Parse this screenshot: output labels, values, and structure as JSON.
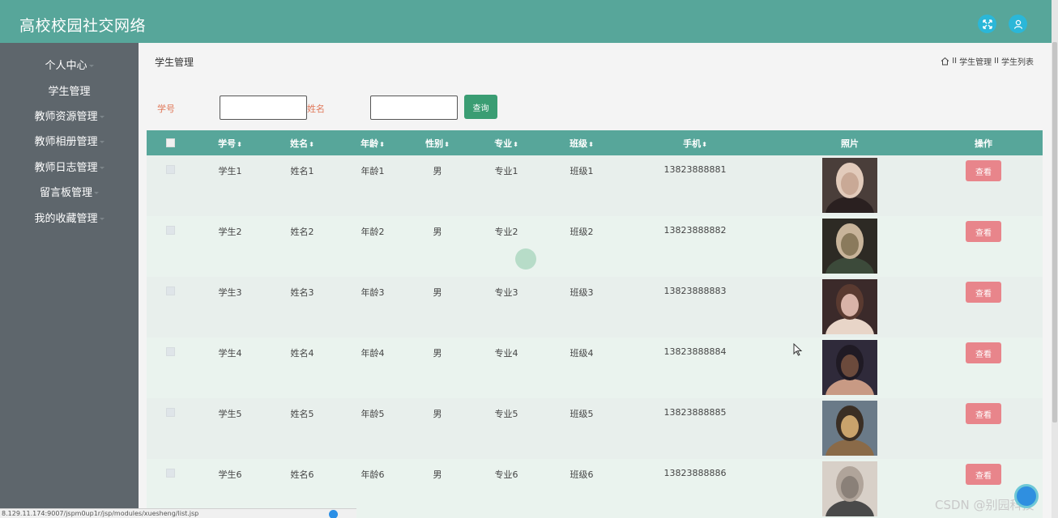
{
  "app": {
    "title": "高校校园社交网络"
  },
  "header": {
    "icons": [
      "fullscreen-icon",
      "user-icon"
    ]
  },
  "sidebar": {
    "items": [
      {
        "label": "个人中心",
        "caret": true
      },
      {
        "label": "学生管理",
        "caret": false
      },
      {
        "label": "教师资源管理",
        "caret": true
      },
      {
        "label": "教师相册管理",
        "caret": true
      },
      {
        "label": "教师日志管理",
        "caret": true
      },
      {
        "label": "留言板管理",
        "caret": true
      },
      {
        "label": "我的收藏管理",
        "caret": true
      }
    ]
  },
  "main": {
    "title": "学生管理",
    "breadcrumb": {
      "separator": "II",
      "items": [
        "学生管理",
        "学生列表"
      ]
    }
  },
  "search": {
    "fields": [
      {
        "label": "学号",
        "value": ""
      },
      {
        "label": "姓名",
        "value": ""
      }
    ],
    "button_label": "查询"
  },
  "table": {
    "headers": [
      "学号",
      "姓名",
      "年龄",
      "性别",
      "专业",
      "班级",
      "手机",
      "照片",
      "操作"
    ],
    "sortable": [
      true,
      true,
      true,
      true,
      true,
      true,
      true,
      false,
      false
    ],
    "action_label": "查看",
    "rows": [
      {
        "id": "学生1",
        "name": "姓名1",
        "age": "年龄1",
        "gender": "男",
        "major": "专业1",
        "class": "班级1",
        "phone": "13823888881"
      },
      {
        "id": "学生2",
        "name": "姓名2",
        "age": "年龄2",
        "gender": "男",
        "major": "专业2",
        "class": "班级2",
        "phone": "13823888882"
      },
      {
        "id": "学生3",
        "name": "姓名3",
        "age": "年龄3",
        "gender": "男",
        "major": "专业3",
        "class": "班级3",
        "phone": "13823888883"
      },
      {
        "id": "学生4",
        "name": "姓名4",
        "age": "年龄4",
        "gender": "男",
        "major": "专业4",
        "class": "班级4",
        "phone": "13823888884"
      },
      {
        "id": "学生5",
        "name": "姓名5",
        "age": "年龄5",
        "gender": "男",
        "major": "专业5",
        "class": "班级5",
        "phone": "13823888885"
      },
      {
        "id": "学生6",
        "name": "姓名6",
        "age": "年龄6",
        "gender": "男",
        "major": "专业6",
        "class": "班级6",
        "phone": "13823888886"
      }
    ]
  },
  "status_bar": {
    "url": "8.129.11.174:9007/jspm0up1r/jsp/modules/xuesheng/list.jsp"
  },
  "watermark": "CSDN @别园科技",
  "colors": {
    "primary": "#57a69a",
    "sidebar": "#5e666c",
    "search_button": "#3a9d73",
    "action_button": "#e8858b",
    "label": "#e0785a"
  }
}
